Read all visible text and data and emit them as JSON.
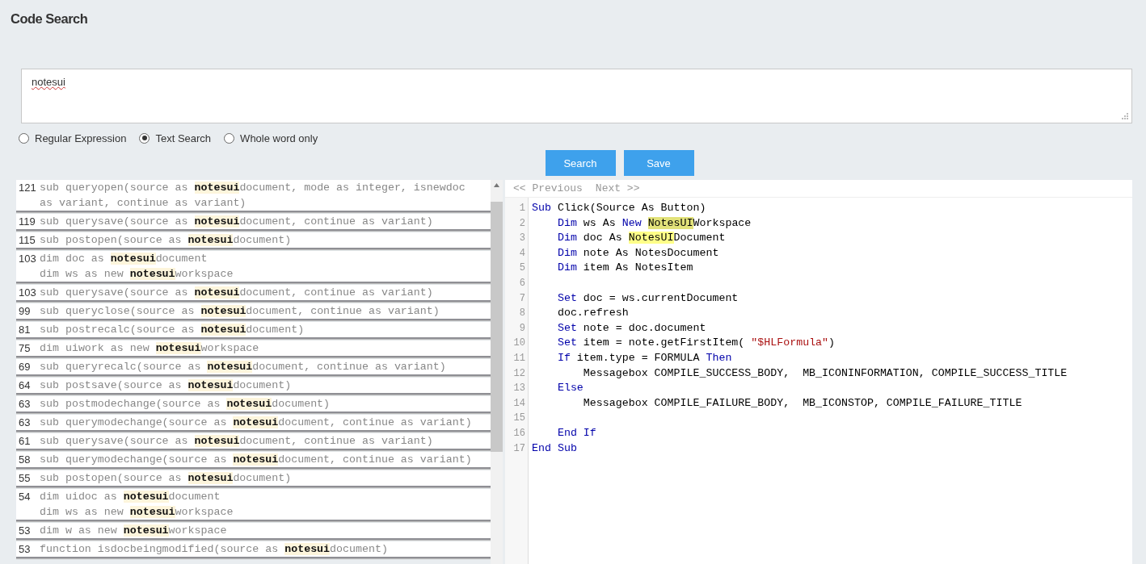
{
  "title": "Code Search",
  "search": {
    "value": "notesui"
  },
  "options": [
    {
      "label": "Regular Expression",
      "selected": false
    },
    {
      "label": "Text Search",
      "selected": true
    },
    {
      "label": "Whole word only",
      "selected": false
    }
  ],
  "buttons": [
    "Search",
    "Save"
  ],
  "results": [
    {
      "count": "121",
      "lines": [
        {
          "before": "sub queryopen(source as ",
          "match": "notesui",
          "after": "document, mode as integer, isnewdoc as variant, continue as variant)"
        }
      ]
    },
    {
      "count": "119",
      "lines": [
        {
          "before": "sub querysave(source as ",
          "match": "notesui",
          "after": "document, continue as variant)"
        }
      ]
    },
    {
      "count": "115",
      "lines": [
        {
          "before": "sub postopen(source as ",
          "match": "notesui",
          "after": "document)"
        }
      ]
    },
    {
      "count": "103",
      "lines": [
        {
          "before": "dim doc as ",
          "match": "notesui",
          "after": "document"
        },
        {
          "before": "dim ws as new ",
          "match": "notesui",
          "after": "workspace"
        }
      ]
    },
    {
      "count": "103",
      "lines": [
        {
          "before": "sub querysave(source as ",
          "match": "notesui",
          "after": "document, continue as variant)"
        }
      ]
    },
    {
      "count": "99",
      "lines": [
        {
          "before": "sub queryclose(source as ",
          "match": "notesui",
          "after": "document, continue as variant)"
        }
      ]
    },
    {
      "count": "81",
      "lines": [
        {
          "before": "sub postrecalc(source as ",
          "match": "notesui",
          "after": "document)"
        }
      ]
    },
    {
      "count": "75",
      "lines": [
        {
          "before": "dim uiwork as new ",
          "match": "notesui",
          "after": "workspace"
        }
      ]
    },
    {
      "count": "69",
      "lines": [
        {
          "before": "sub queryrecalc(source as ",
          "match": "notesui",
          "after": "document, continue as variant)"
        }
      ]
    },
    {
      "count": "64",
      "lines": [
        {
          "before": "sub postsave(source as ",
          "match": "notesui",
          "after": "document)"
        }
      ]
    },
    {
      "count": "63",
      "lines": [
        {
          "before": "sub postmodechange(source as ",
          "match": "notesui",
          "after": "document)"
        }
      ]
    },
    {
      "count": "63",
      "lines": [
        {
          "before": "sub querymodechange(source as ",
          "match": "notesui",
          "after": "document, continue as variant)"
        }
      ]
    },
    {
      "count": "61",
      "lines": [
        {
          "before": "sub querysave(source as ",
          "match": "notesui",
          "after": "document, continue as variant)"
        }
      ]
    },
    {
      "count": "58",
      "lines": [
        {
          "before": "sub querymodechange(source as ",
          "match": "notesui",
          "after": "document, continue as variant)"
        }
      ]
    },
    {
      "count": "55",
      "lines": [
        {
          "before": "sub postopen(source as ",
          "match": "notesui",
          "after": "document)"
        }
      ]
    },
    {
      "count": "54",
      "lines": [
        {
          "before": "dim uidoc as ",
          "match": "notesui",
          "after": "document"
        },
        {
          "before": "dim ws as new ",
          "match": "notesui",
          "after": "workspace"
        }
      ]
    },
    {
      "count": "53",
      "lines": [
        {
          "before": "dim w as new ",
          "match": "notesui",
          "after": "workspace"
        }
      ]
    },
    {
      "count": "53",
      "lines": [
        {
          "before": "function isdocbeingmodified(source as ",
          "match": "notesui",
          "after": "document)"
        }
      ]
    }
  ],
  "pager": {
    "previous": "<< Previous",
    "next": "Next >>"
  },
  "code": [
    {
      "number": "1",
      "tokens": [
        {
          "kind": "keyword",
          "text": "Sub"
        },
        {
          "kind": "plain",
          "text": " Click(Source As Button)"
        }
      ]
    },
    {
      "number": "2",
      "tokens": [
        {
          "kind": "keyword",
          "text": "    Dim"
        },
        {
          "kind": "plain",
          "text": " ws As "
        },
        {
          "kind": "keyword",
          "text": "New "
        },
        {
          "kind": "current-match",
          "text": "NotesUI"
        },
        {
          "kind": "plain",
          "text": "Workspace"
        }
      ]
    },
    {
      "number": "3",
      "tokens": [
        {
          "kind": "keyword",
          "text": "    Dim"
        },
        {
          "kind": "plain",
          "text": " doc As "
        },
        {
          "kind": "match",
          "text": "NotesUI"
        },
        {
          "kind": "plain",
          "text": "Document"
        }
      ]
    },
    {
      "number": "4",
      "tokens": [
        {
          "kind": "keyword",
          "text": "    Dim"
        },
        {
          "kind": "plain",
          "text": " note As NotesDocument"
        }
      ]
    },
    {
      "number": "5",
      "tokens": [
        {
          "kind": "keyword",
          "text": "    Dim"
        },
        {
          "kind": "plain",
          "text": " item As NotesItem"
        }
      ]
    },
    {
      "number": "6"
    },
    {
      "number": "7",
      "tokens": [
        {
          "kind": "keyword",
          "text": "    Set"
        },
        {
          "kind": "plain",
          "text": " doc = ws.currentDocument"
        }
      ]
    },
    {
      "number": "8",
      "tokens": [
        {
          "kind": "plain",
          "text": "    doc.refresh"
        }
      ]
    },
    {
      "number": "9",
      "tokens": [
        {
          "kind": "keyword",
          "text": "    Set"
        },
        {
          "kind": "plain",
          "text": " note = doc.document"
        }
      ]
    },
    {
      "number": "10",
      "tokens": [
        {
          "kind": "keyword",
          "text": "    Set"
        },
        {
          "kind": "plain",
          "text": " item = note.getFirstItem( "
        },
        {
          "kind": "string",
          "text": "\"$HLFormula\""
        },
        {
          "kind": "plain",
          "text": ")"
        }
      ]
    },
    {
      "number": "11",
      "tokens": [
        {
          "kind": "keyword",
          "text": "    If"
        },
        {
          "kind": "plain",
          "text": " item.type = FORMULA "
        },
        {
          "kind": "keyword",
          "text": "Then"
        }
      ]
    },
    {
      "number": "12",
      "tokens": [
        {
          "kind": "plain",
          "text": "        Messagebox COMPILE_SUCCESS_BODY,  MB_ICONINFORMATION, COMPILE_SUCCESS_TITLE"
        }
      ]
    },
    {
      "number": "13",
      "tokens": [
        {
          "kind": "keyword",
          "text": "    Else"
        }
      ]
    },
    {
      "number": "14",
      "tokens": [
        {
          "kind": "plain",
          "text": "        Messagebox COMPILE_FAILURE_BODY,  MB_ICONSTOP, COMPILE_FAILURE_TITLE"
        }
      ]
    },
    {
      "number": "15"
    },
    {
      "number": "16",
      "tokens": [
        {
          "kind": "keyword",
          "text": "    End If"
        }
      ]
    },
    {
      "number": "17",
      "tokens": [
        {
          "kind": "keyword",
          "text": "End Sub"
        }
      ]
    }
  ]
}
